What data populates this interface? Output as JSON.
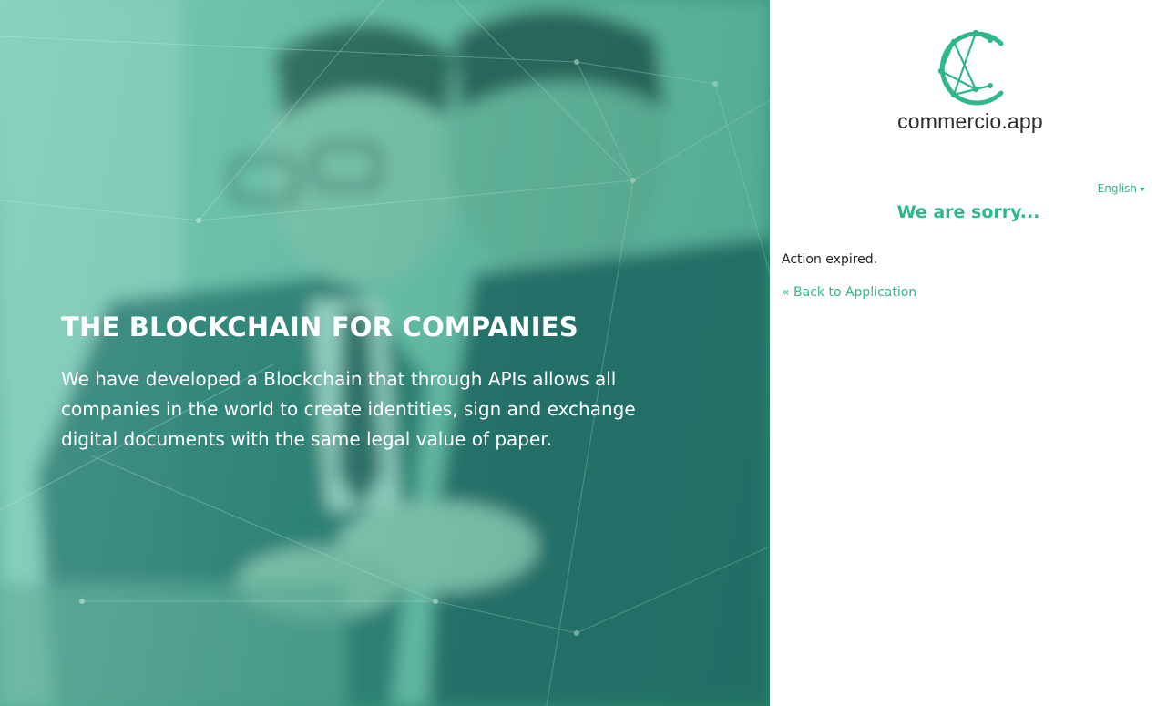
{
  "hero": {
    "title": "THE BLOCKCHAIN FOR COMPANIES",
    "description": "We have developed a Blockchain that through APIs allows all companies in the world to create identities, sign and exchange digital documents with the same legal value of paper."
  },
  "brand": {
    "name": "commercio.app",
    "accent_color": "#2fb886",
    "logo_icon": "commercio-c-network-icon"
  },
  "language": {
    "selected": "English"
  },
  "error": {
    "heading": "We are sorry...",
    "message": "Action expired.",
    "back_link": "« Back to Application"
  }
}
